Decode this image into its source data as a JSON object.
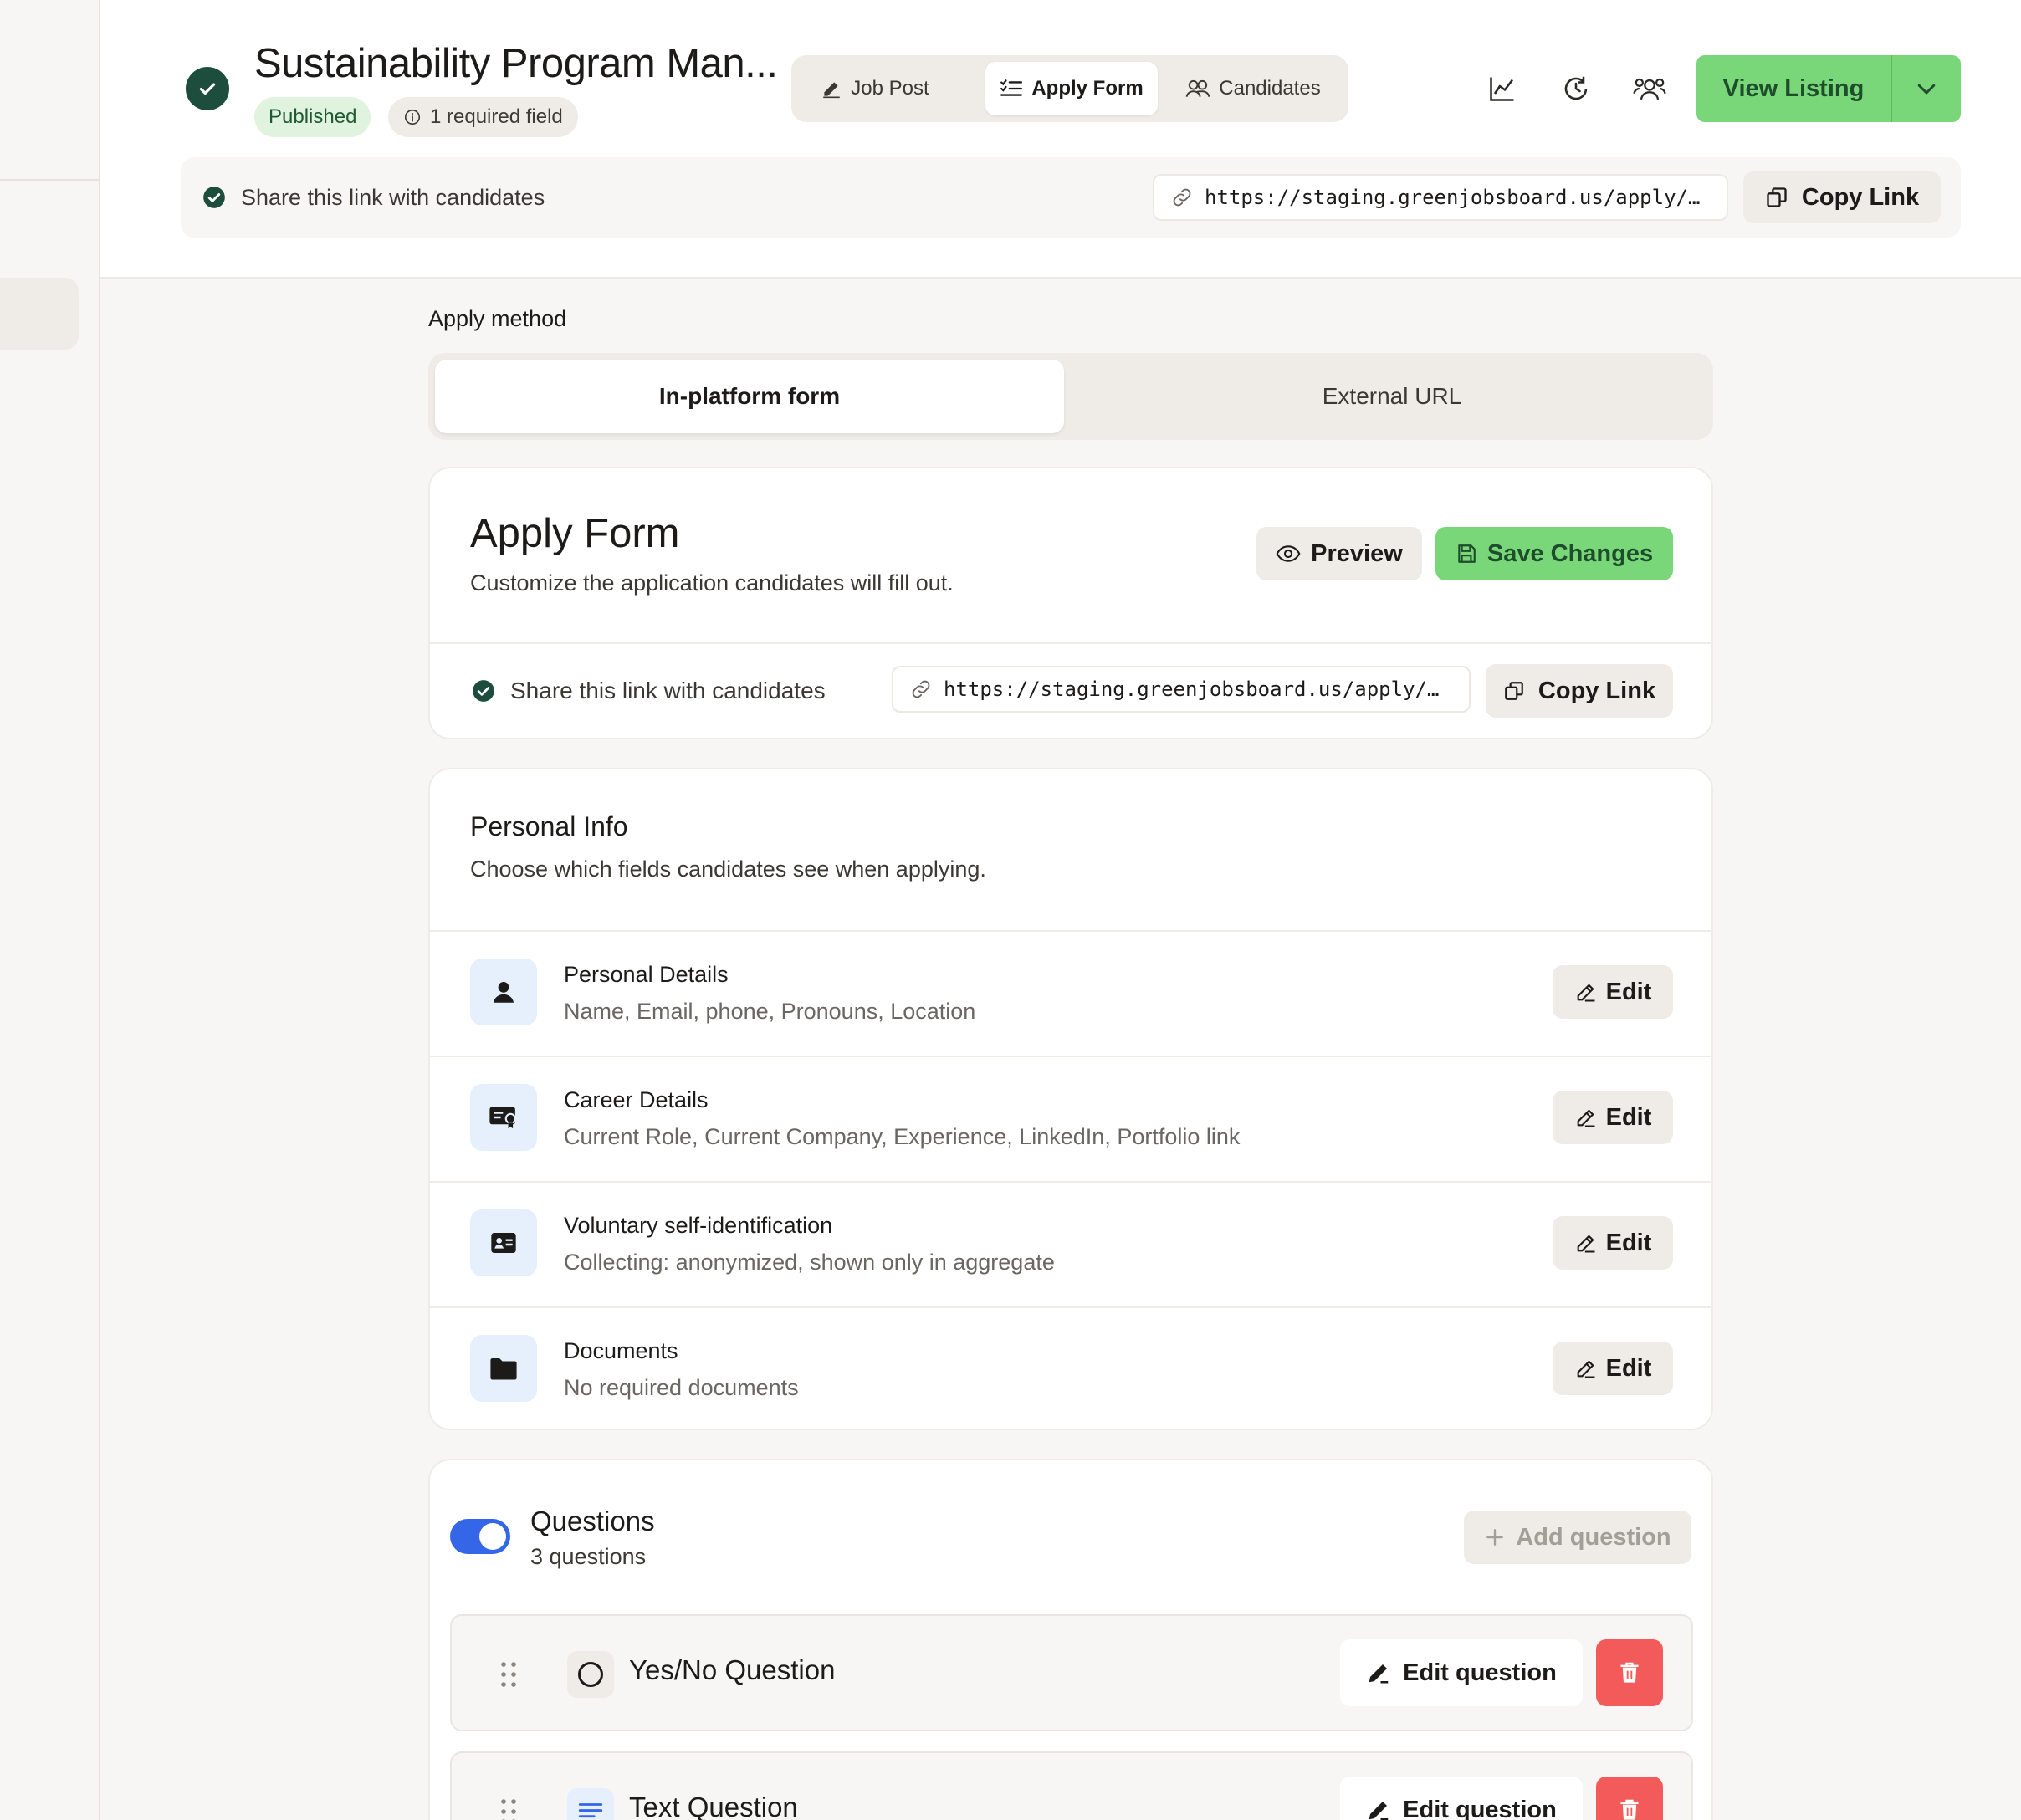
{
  "header": {
    "job_title": "Sustainability Program Man...",
    "status_badge": "Published",
    "required_badge": "1 required field",
    "tabs": [
      {
        "label": "Job Post",
        "icon": "pencil-icon",
        "active": false
      },
      {
        "label": "Apply Form",
        "icon": "checklist-icon",
        "active": true
      },
      {
        "label": "Candidates",
        "icon": "users-icon",
        "active": false
      }
    ],
    "action_icons": [
      "analytics-chart-icon",
      "history-icon",
      "team-icon"
    ],
    "view_listing_label": "View Listing",
    "share_text": "Share this link with candidates",
    "share_url": "https://staging.greenjobsboard.us/apply/…",
    "copy_link_label": "Copy Link"
  },
  "apply_method": {
    "label": "Apply method",
    "options": [
      "In-platform form",
      "External URL"
    ],
    "selected": "In-platform form"
  },
  "apply_form": {
    "title": "Apply Form",
    "subtitle": "Customize the application candidates will fill out.",
    "preview_label": "Preview",
    "save_label": "Save Changes",
    "share_text": "Share this link with candidates",
    "share_url": "https://staging.greenjobsboard.us/apply/…",
    "copy_link_label": "Copy Link"
  },
  "personal_info": {
    "title": "Personal Info",
    "subtitle": "Choose which fields candidates see when applying.",
    "edit_label": "Edit",
    "rows": [
      {
        "name": "Personal Details",
        "desc": "Name, Email, phone, Pronouns, Location",
        "icon": "person-icon"
      },
      {
        "name": "Career Details",
        "desc": "Current Role, Current Company, Experience, LinkedIn, Portfolio link",
        "icon": "certificate-icon"
      },
      {
        "name": "Voluntary self-identification",
        "desc": "Collecting: anonymized, shown only in aggregate",
        "icon": "id-card-icon"
      },
      {
        "name": "Documents",
        "desc": "No required documents",
        "icon": "folder-icon"
      }
    ]
  },
  "questions": {
    "title": "Questions",
    "count_text": "3 questions",
    "enabled": true,
    "add_label": "Add question",
    "edit_label": "Edit question",
    "items": [
      {
        "label": "Yes/No Question",
        "icon": "radio-circle-icon"
      },
      {
        "label": "Text Question",
        "icon": "text-lines-icon"
      }
    ]
  },
  "colors": {
    "accent_green": "#79d77a",
    "dark_green": "#1d4d3c",
    "toggle_blue": "#3566e8",
    "delete_red": "#f35b5b"
  }
}
